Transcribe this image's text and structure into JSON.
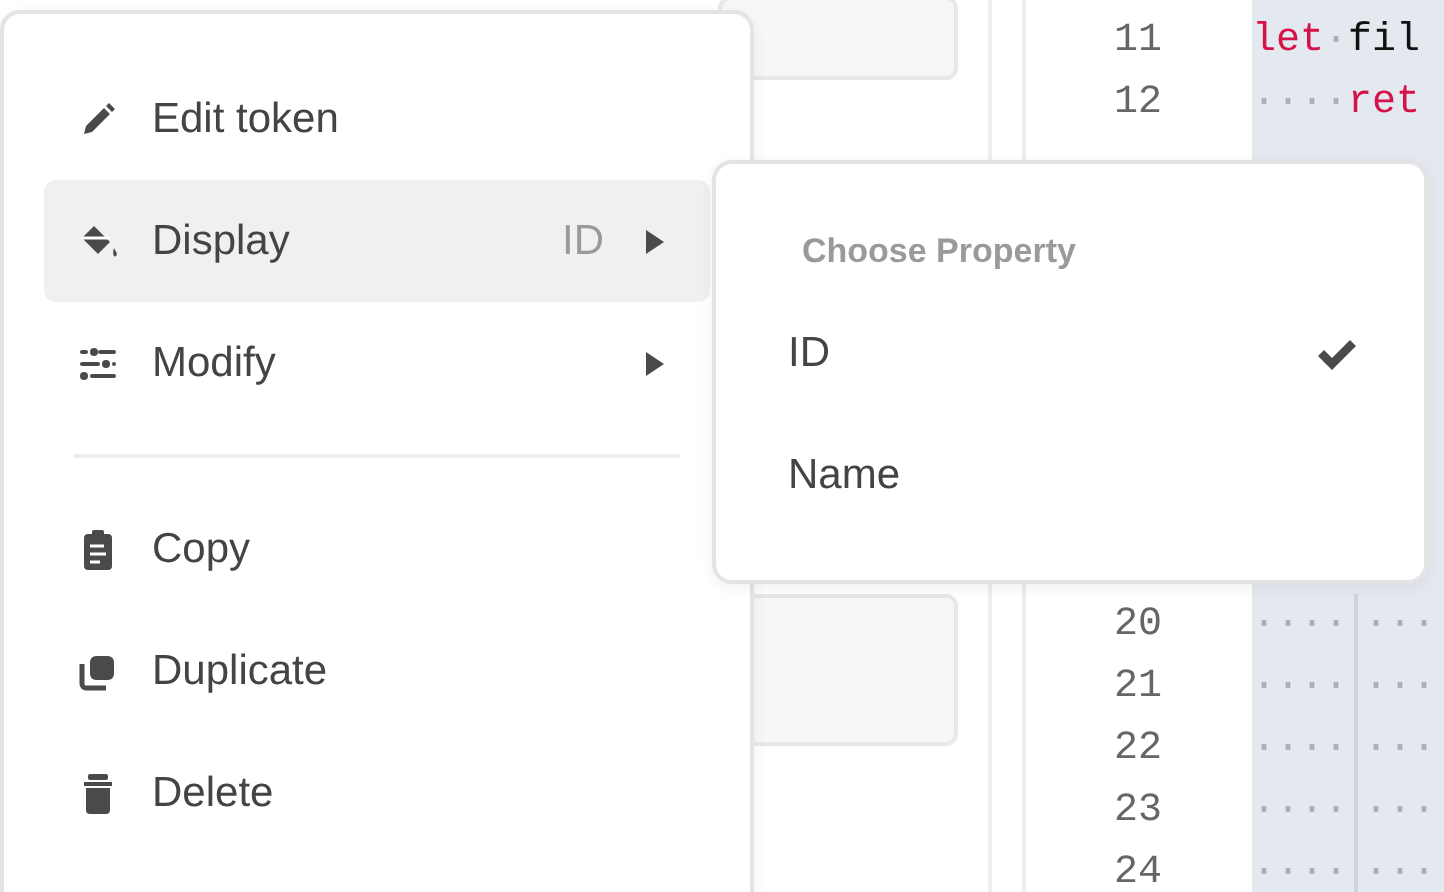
{
  "menu": {
    "groups": [
      {
        "items": [
          {
            "kind": "action",
            "label": "Edit token",
            "selected": false
          },
          {
            "kind": "submenu",
            "label": "Display",
            "hint": "ID",
            "selected": true
          },
          {
            "kind": "submenu",
            "label": "Modify",
            "selected": false
          }
        ]
      },
      {
        "items": [
          {
            "kind": "action",
            "label": "Copy",
            "selected": false
          },
          {
            "kind": "action",
            "label": "Duplicate",
            "selected": false
          },
          {
            "kind": "action",
            "label": "Delete",
            "selected": false
          }
        ]
      }
    ]
  },
  "submenu": {
    "title": "Choose Property",
    "options": [
      {
        "label": "ID",
        "selected": true
      },
      {
        "label": "Name",
        "selected": false
      }
    ]
  },
  "editor": {
    "blocks": [
      {
        "lines": [
          {
            "number": "11",
            "code": [
              {
                "kind": "keyword",
                "text": "let"
              },
              {
                "kind": "space",
                "text": "·"
              },
              {
                "kind": "plain",
                "text": "fil"
              }
            ]
          },
          {
            "number": "12",
            "code": [
              {
                "kind": "space",
                "text": "····"
              },
              {
                "kind": "keyword",
                "text": "ret"
              }
            ]
          }
        ]
      },
      {
        "lines": [
          {
            "number": "20",
            "code": [
              {
                "kind": "space",
                "text": "····"
              },
              {
                "kind": "guide"
              },
              {
                "kind": "space",
                "text": "···"
              }
            ]
          },
          {
            "number": "21",
            "code": [
              {
                "kind": "space",
                "text": "····"
              },
              {
                "kind": "guide"
              },
              {
                "kind": "space",
                "text": "···"
              }
            ]
          },
          {
            "number": "22",
            "code": [
              {
                "kind": "space",
                "text": "····"
              },
              {
                "kind": "guide"
              },
              {
                "kind": "space",
                "text": "···"
              }
            ]
          },
          {
            "number": "23",
            "code": [
              {
                "kind": "space",
                "text": "····"
              },
              {
                "kind": "guide"
              },
              {
                "kind": "space",
                "text": "···"
              }
            ]
          },
          {
            "number": "24",
            "code": [
              {
                "kind": "space",
                "text": "····"
              },
              {
                "kind": "guide"
              },
              {
                "kind": "space",
                "text": "···"
              }
            ]
          }
        ]
      }
    ]
  }
}
